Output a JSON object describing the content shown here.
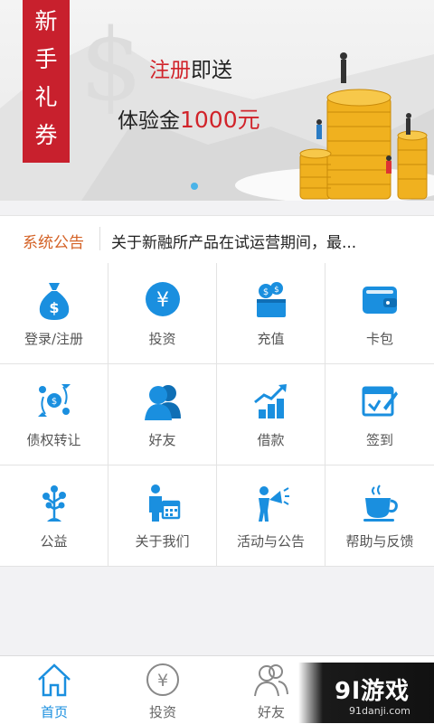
{
  "banner": {
    "tag_chars": [
      "新",
      "手",
      "礼",
      "券"
    ],
    "line1_red": "注册",
    "line1_rest": "即送",
    "line2_prefix": "体验金",
    "line2_amount": "1000元"
  },
  "notice": {
    "label": "系统公告",
    "text": "关于新融所产品在试运营期间，最..."
  },
  "grid": {
    "items": [
      {
        "label": "登录/注册",
        "icon": "money-bag-icon"
      },
      {
        "label": "投资",
        "icon": "yen-circle-icon"
      },
      {
        "label": "充值",
        "icon": "coin-box-icon"
      },
      {
        "label": "卡包",
        "icon": "wallet-icon"
      },
      {
        "label": "债权转让",
        "icon": "transfer-icon"
      },
      {
        "label": "好友",
        "icon": "friends-icon"
      },
      {
        "label": "借款",
        "icon": "growth-chart-icon"
      },
      {
        "label": "签到",
        "icon": "checkin-icon"
      },
      {
        "label": "公益",
        "icon": "tree-icon"
      },
      {
        "label": "关于我们",
        "icon": "presenter-icon"
      },
      {
        "label": "活动与公告",
        "icon": "megaphone-icon"
      },
      {
        "label": "帮助与反馈",
        "icon": "coffee-cup-icon"
      }
    ]
  },
  "nav": {
    "items": [
      {
        "label": "首页",
        "icon": "home-icon",
        "active": true
      },
      {
        "label": "投资",
        "icon": "yen-circle-icon",
        "active": false
      },
      {
        "label": "好友",
        "icon": "friends-icon",
        "active": false
      },
      {
        "label": "",
        "icon": "profile-icon",
        "active": false
      }
    ]
  },
  "watermark": {
    "main": "9l游戏",
    "sub": "91danji.com"
  },
  "colors": {
    "accent_blue": "#1a8fdf",
    "tag_red": "#c8202d",
    "notice_orange": "#d46226"
  }
}
